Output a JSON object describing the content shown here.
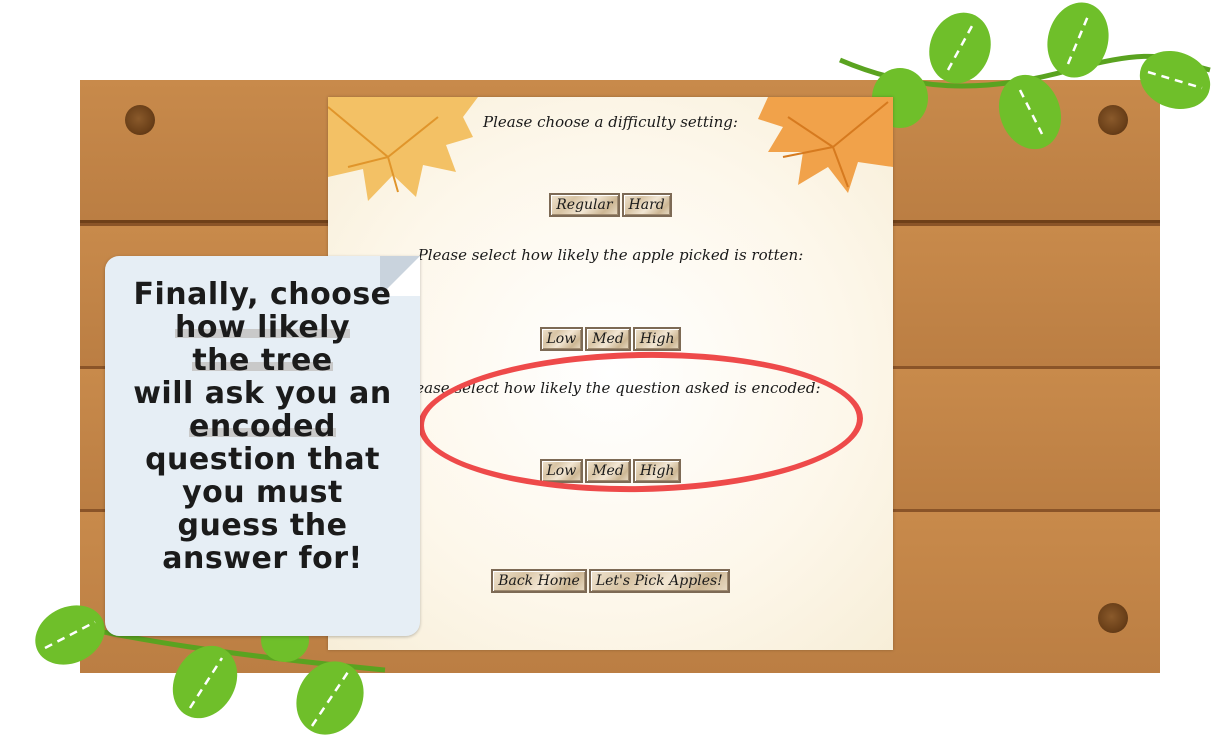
{
  "difficulty": {
    "prompt": "Please choose a difficulty setting:",
    "options": [
      "Regular",
      "Hard"
    ]
  },
  "rotten": {
    "prompt": "Please select how likely the apple picked is rotten:",
    "options": [
      "Low",
      "Med",
      "High"
    ]
  },
  "encoded": {
    "prompt": "Please select how likely the question asked is encoded:",
    "options": [
      "Low",
      "Med",
      "High"
    ]
  },
  "nav": {
    "back_label": "Back Home",
    "start_label": "Let's Pick Apples!"
  },
  "tutorial_note": {
    "lines": [
      "Finally, choose",
      "how likely",
      "the tree",
      "will ask you an",
      "encoded",
      "question that",
      "you must",
      "guess the",
      "answer for!"
    ]
  },
  "colors": {
    "wood": "#c88a4b",
    "highlight_ring": "#ee4a4a",
    "leaf_green": "#6fbf2a",
    "note_bg": "#e6eef5"
  }
}
